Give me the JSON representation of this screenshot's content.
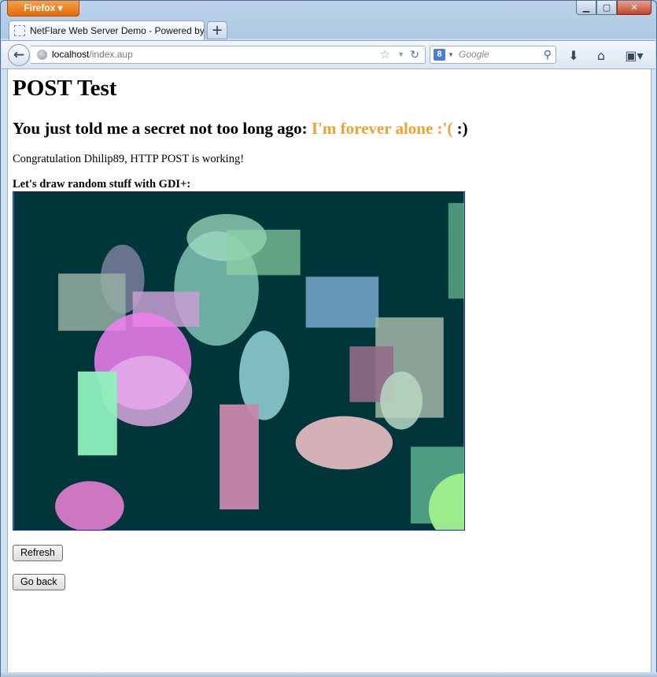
{
  "browser": {
    "menu_button": "Firefox",
    "tab_title": "NetFlare Web Server Demo - Powered by...",
    "new_tab_label": "+",
    "url_host": "localhost",
    "url_path": "/index.aup",
    "search_placeholder": "Google",
    "search_engine_letter": "8"
  },
  "page": {
    "heading": "POST Test",
    "secret_prefix": "You just told me a secret not too long ago: ",
    "secret_message": "I'm forever alone :'(",
    "secret_suffix": " :)",
    "congrats": "Congratulation Dhilip89, HTTP POST is working!",
    "draw_label": "Let's draw random stuff with GDI+:",
    "refresh_button": "Refresh",
    "back_button": "Go back"
  },
  "colors": {
    "canvas_background": "#00353a",
    "secret_message": "#f0a030"
  },
  "canvas_shapes": [
    {
      "kind": "rect",
      "color": "#5aa684",
      "opacity": 0.85
    },
    {
      "kind": "ellipse",
      "color": "#7fc4b5",
      "opacity": 0.85
    },
    {
      "kind": "ellipse",
      "color": "#a0dcc0",
      "opacity": 0.75
    },
    {
      "kind": "rect",
      "color": "#8ed1a6",
      "opacity": 0.7
    },
    {
      "kind": "ellipse",
      "color": "#7a7f9c",
      "opacity": 0.85
    },
    {
      "kind": "rect",
      "color": "#95aea3",
      "opacity": 0.85
    },
    {
      "kind": "rect",
      "color": "#c79fd2",
      "opacity": 0.85
    },
    {
      "kind": "rect",
      "color": "#6b9cbc",
      "opacity": 0.95
    },
    {
      "kind": "rect",
      "color": "#a3b6a7",
      "opacity": 0.85
    },
    {
      "kind": "rect",
      "color": "#946c88",
      "opacity": 0.9
    },
    {
      "kind": "ellipse",
      "color": "#f27ff0",
      "opacity": 0.85
    },
    {
      "kind": "ellipse",
      "color": "#e6b0ea",
      "opacity": 0.8
    },
    {
      "kind": "rect",
      "color": "#8ef0bc",
      "opacity": 0.95
    },
    {
      "kind": "ellipse",
      "color": "#86c4c6",
      "opacity": 0.95
    },
    {
      "kind": "ellipse",
      "color": "#b9d7c3",
      "opacity": 0.85
    },
    {
      "kind": "rect",
      "color": "#c887ab",
      "opacity": 0.95
    },
    {
      "kind": "ellipse",
      "color": "#dab6bb",
      "opacity": 0.97
    },
    {
      "kind": "rect",
      "color": "#52a285",
      "opacity": 0.95
    },
    {
      "kind": "ellipse",
      "color": "#a0f08c",
      "opacity": 0.97
    },
    {
      "kind": "ellipse",
      "color": "#d47ac4",
      "opacity": 0.97
    }
  ]
}
